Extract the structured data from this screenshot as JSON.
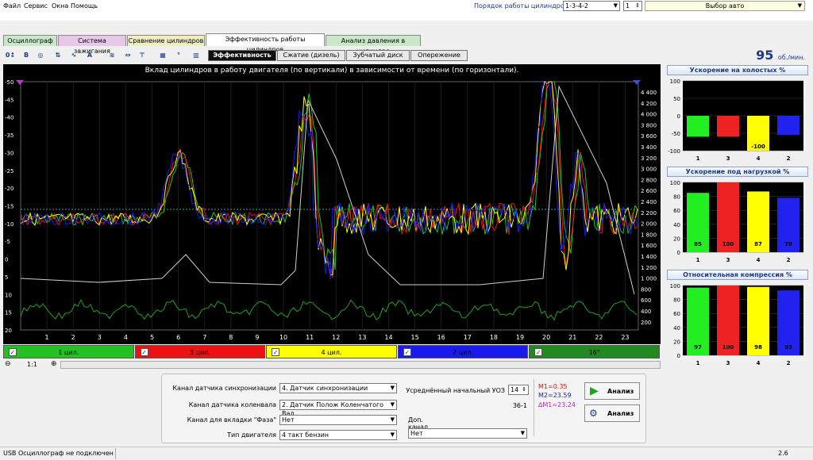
{
  "menu": [
    "Файл",
    "Сервис",
    "Окна",
    "Помощь"
  ],
  "cyl_order": {
    "label": "Порядок работы цилиндров",
    "value": "1-3-4-2",
    "num": "1"
  },
  "auto_select": "Выбор авто",
  "tabs": [
    "Осциллограф",
    "Система зажигания",
    "Сравнение цилиндров",
    "Эффективность работы цилиндров",
    "Анализ давления в цилиндре"
  ],
  "subtabs": [
    "Эффективность",
    "Сжатие (дизель)",
    "Зубчатый диск",
    "Опережение"
  ],
  "rpm": {
    "value": "95",
    "unit": "об./мин."
  },
  "toolbar_icons": [
    "marker-icon",
    "bold-b-icon",
    "rpm-icon",
    "scale-icon",
    "wave-icon",
    "alg-icon",
    "filter-icon",
    "zoom-icon",
    "text-icon",
    "bars-icon",
    "degree-icon",
    "chart-icon",
    "settings-icon"
  ],
  "graph": {
    "title": "Вклад цилиндров в работу двигателя (по вертикали) в зависимости от времени (по горизонтали).",
    "left_ticks": [
      "-50",
      "-45",
      "-40",
      "-35",
      "-30",
      "-25",
      "-20",
      "-15",
      "-10",
      "-5",
      "0",
      "5",
      "10",
      "15",
      "20"
    ],
    "right_ticks": [
      "4 400",
      "4 200",
      "4 000",
      "3 800",
      "3 600",
      "3 400",
      "3 200",
      "3 000",
      "2 800",
      "2 600",
      "2 400",
      "2 200",
      "2 000",
      "1 800",
      "1 600",
      "1 400",
      "1 200",
      "1 000",
      "800",
      "600",
      "400",
      "200"
    ],
    "x_ticks": [
      "1",
      "2",
      "3",
      "4",
      "5",
      "6",
      "7",
      "8",
      "9",
      "10",
      "11",
      "12",
      "13",
      "14",
      "15",
      "16",
      "17",
      "18",
      "19",
      "20",
      "21",
      "22",
      "23"
    ]
  },
  "legend": [
    {
      "label": "1 цил.",
      "color": "#22c222"
    },
    {
      "label": "3 цил.",
      "color": "#ee1111"
    },
    {
      "label": "4 цил.",
      "color": "#ffff00"
    },
    {
      "label": "2 цил.",
      "color": "#1a1aee"
    },
    {
      "label": "16°",
      "color": "#208a20"
    }
  ],
  "zoom": "1:1",
  "form": {
    "sync_label": "Канал датчика синхронизации",
    "sync_value": "4. Датчик синхронизации",
    "crank_label": "Канал датчика коленвала",
    "crank_value": "2. Датчик Полож Коленчатого Вал",
    "phase_label": "Канал для вкладки \"Фаза\"",
    "phase_value": "Нет",
    "engine_label": "Тип двигателя",
    "engine_value": "4 такт бензин",
    "uoz_label": "Усреднённый начальный УОЗ",
    "uoz_value": "14",
    "tooth": "36-1",
    "extra_label": "Доп. канал",
    "extra_value": "Нет",
    "m1": "M1=0.35",
    "m2": "M2=23.59",
    "dm": "∆M1=23.24",
    "analyze1": "Анализ",
    "analyze2": "Анализ"
  },
  "status": {
    "text": "USB Осциллограф не подключен",
    "version": "2.6"
  },
  "chart_data": [
    {
      "type": "bar",
      "title": "Ускорение на холостых %",
      "categories": [
        "1",
        "3",
        "4",
        "2"
      ],
      "values": [
        -60,
        -60,
        -100,
        -55
      ],
      "ylim": [
        -100,
        100
      ],
      "yticks": [
        "100",
        "50",
        "0",
        "-50",
        "-100"
      ],
      "labels": [
        "",
        "",
        "-100",
        ""
      ],
      "colors": [
        "#22ee22",
        "#ee2222",
        "#ffff00",
        "#2222ee"
      ]
    },
    {
      "type": "bar",
      "title": "Ускорение под нагрузкой %",
      "categories": [
        "1",
        "3",
        "4",
        "2"
      ],
      "values": [
        85,
        100,
        87,
        78
      ],
      "ylim": [
        0,
        100
      ],
      "yticks": [
        "100",
        "80",
        "60",
        "40",
        "20",
        "0"
      ],
      "labels": [
        "85",
        "100",
        "87",
        "78"
      ],
      "colors": [
        "#22ee22",
        "#ee2222",
        "#ffff00",
        "#2222ee"
      ]
    },
    {
      "type": "bar",
      "title": "Относительная компрессия %",
      "categories": [
        "1",
        "3",
        "4",
        "2"
      ],
      "values": [
        97,
        100,
        98,
        93
      ],
      "ylim": [
        0,
        100
      ],
      "yticks": [
        "100",
        "80",
        "60",
        "40",
        "20",
        "0"
      ],
      "labels": [
        "97",
        "100",
        "98",
        "93"
      ],
      "colors": [
        "#22ee22",
        "#ee2222",
        "#ffff00",
        "#2222ee"
      ]
    }
  ]
}
